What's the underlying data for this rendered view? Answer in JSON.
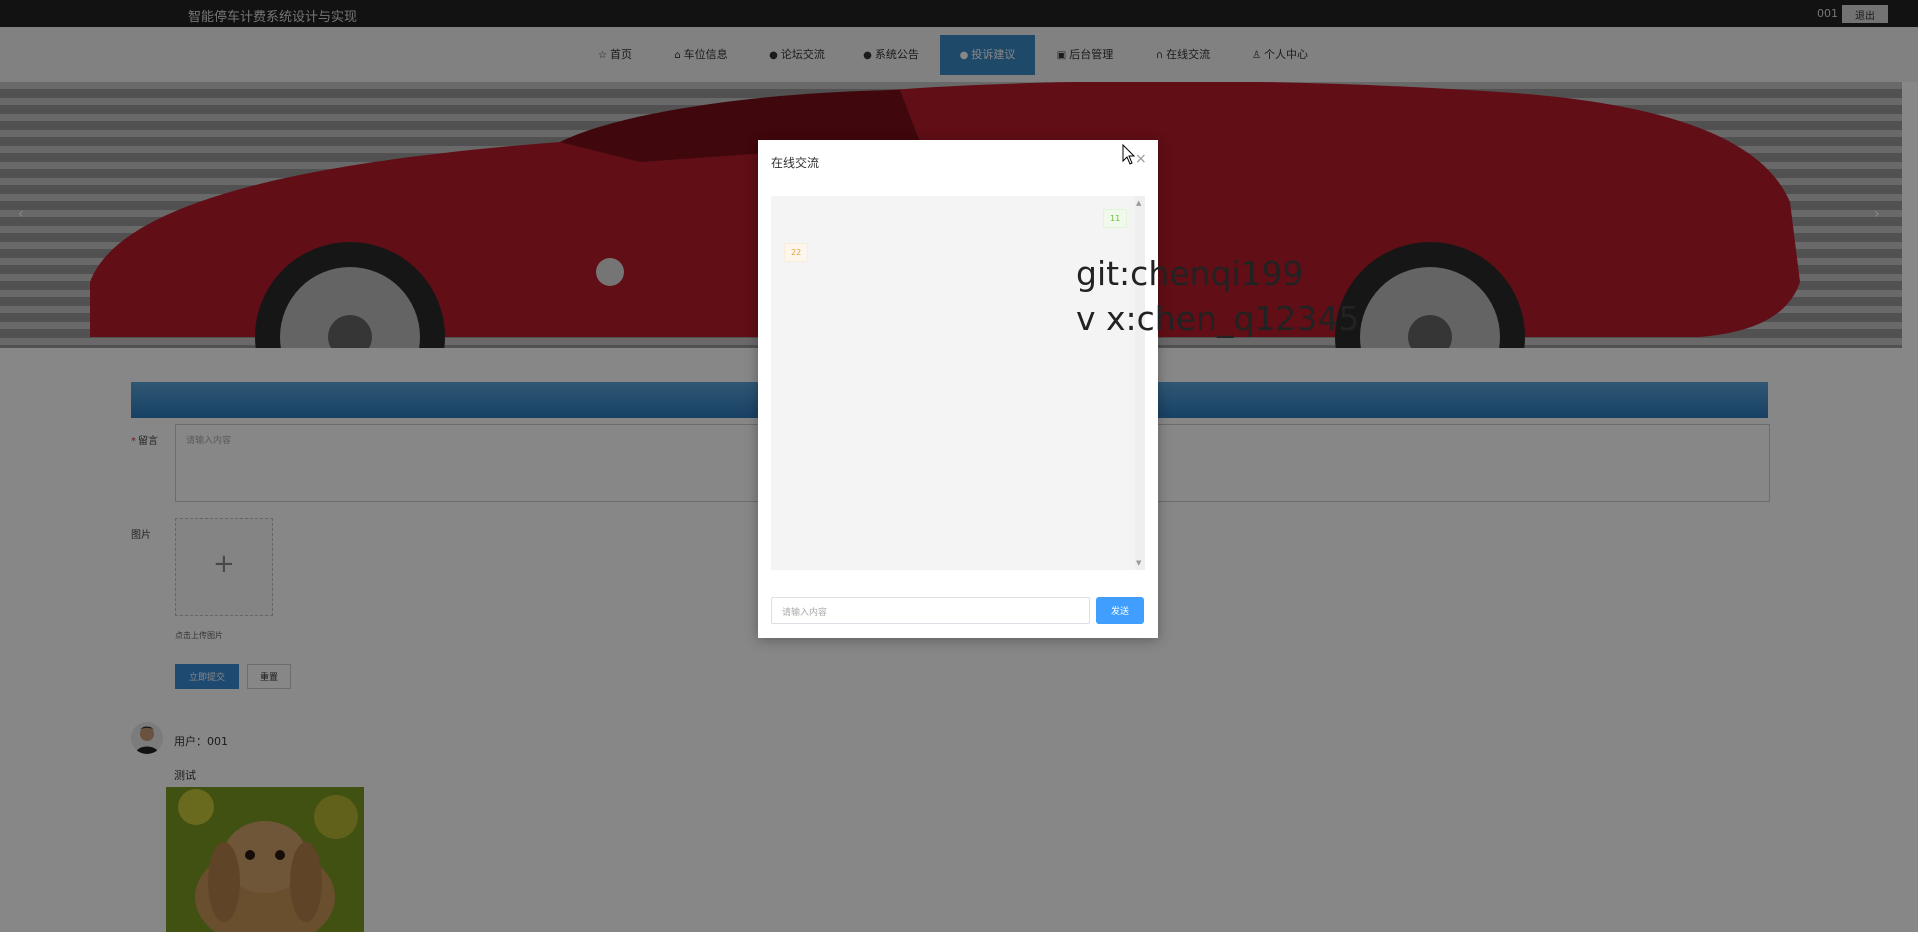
{
  "app": {
    "title": "智能停车计费系统设计与实现",
    "username": "001",
    "logout_label": "退出"
  },
  "nav": {
    "items": [
      {
        "label": "首页",
        "icon": "star-icon"
      },
      {
        "label": "车位信息",
        "icon": "lock-icon"
      },
      {
        "label": "论坛交流",
        "icon": "info-icon"
      },
      {
        "label": "系统公告",
        "icon": "question-icon"
      },
      {
        "label": "投诉建议",
        "icon": "info-icon",
        "active": true
      },
      {
        "label": "后台管理",
        "icon": "box-icon"
      },
      {
        "label": "在线交流",
        "icon": "headset-icon"
      },
      {
        "label": "个人中心",
        "icon": "user-icon"
      }
    ],
    "active_color": "#3a8bc6"
  },
  "form": {
    "message_label": "留言",
    "message_placeholder": "请输入内容",
    "image_label": "图片",
    "upload_tip": "点击上传图片",
    "submit_label": "立即提交",
    "reset_label": "重置"
  },
  "comment": {
    "user_line": "用户：001",
    "text": "测试"
  },
  "chat": {
    "title": "在线交流",
    "messages": [
      {
        "side": "right",
        "text": "11"
      },
      {
        "side": "left",
        "text": "22"
      }
    ],
    "input_placeholder": "请输入内容",
    "send_label": "发送"
  },
  "watermark": {
    "line1": "git:chenqi199",
    "line2": "v x:chen_q12345"
  },
  "colors": {
    "topbar": "#222222",
    "section_bar": "#3a8bc6",
    "send_button": "#409eff",
    "submit_button": "#3a8bd6"
  }
}
